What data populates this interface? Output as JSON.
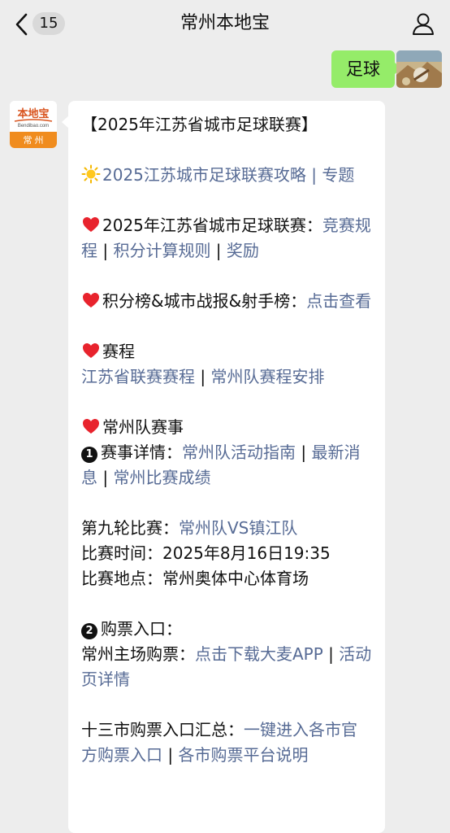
{
  "header": {
    "title": "常州本地宝",
    "unread_count": "15"
  },
  "sent_message": {
    "text": "足球"
  },
  "bot_avatar": {
    "logo_text": "本地宝",
    "site_text": "Bendibao.com",
    "city": "常 州"
  },
  "message": {
    "heading": "【2025年江苏省城市足球联赛】",
    "p1": {
      "link": "2025江苏城市足球联赛攻略 | 专题"
    },
    "p2": {
      "text": "2025年江苏省城市足球联赛：",
      "link1": "竞赛规程",
      "sep1": " | ",
      "link2": "积分计算规则",
      "sep2": " | ",
      "link3": "奖励"
    },
    "p3": {
      "text": "积分榜&城市战报&射手榜：",
      "link": "点击查看"
    },
    "p4": {
      "text": "赛程",
      "link1": "江苏省联赛赛程",
      "sep": " | ",
      "link2": "常州队赛程安排"
    },
    "p5": {
      "text": "常州队赛事",
      "item_num": "1",
      "item_label": "赛事详情：",
      "link1": "常州队活动指南",
      "sep1": " | ",
      "link2": "最新消息",
      "sep2": " | ",
      "link3": "常州比赛成绩"
    },
    "p6": {
      "round_label": "第九轮比赛：",
      "round_link": "常州队VS镇江队",
      "time": "比赛时间：2025年8月16日19:35",
      "venue": "比赛地点：常州奥体中心体育场"
    },
    "p7": {
      "item_num": "2",
      "item_label": "购票入口：",
      "home_label": "常州主场购票：",
      "link1": "点击下载大麦APP",
      "sep": " | ",
      "link2": "活动页详情"
    },
    "p8": {
      "label": "十三市购票入口汇总：",
      "link1": "一键进入各市官方购票入口",
      "sep": " | ",
      "link2": "各市购票平台说明"
    }
  },
  "colors": {
    "link": "#576b95",
    "sent_bubble": "#95ec69",
    "background": "#ededed"
  },
  "icons": {
    "back": "chevron-left-icon",
    "user": "user-icon",
    "sun": "sun-icon",
    "heart": "heart-icon"
  }
}
